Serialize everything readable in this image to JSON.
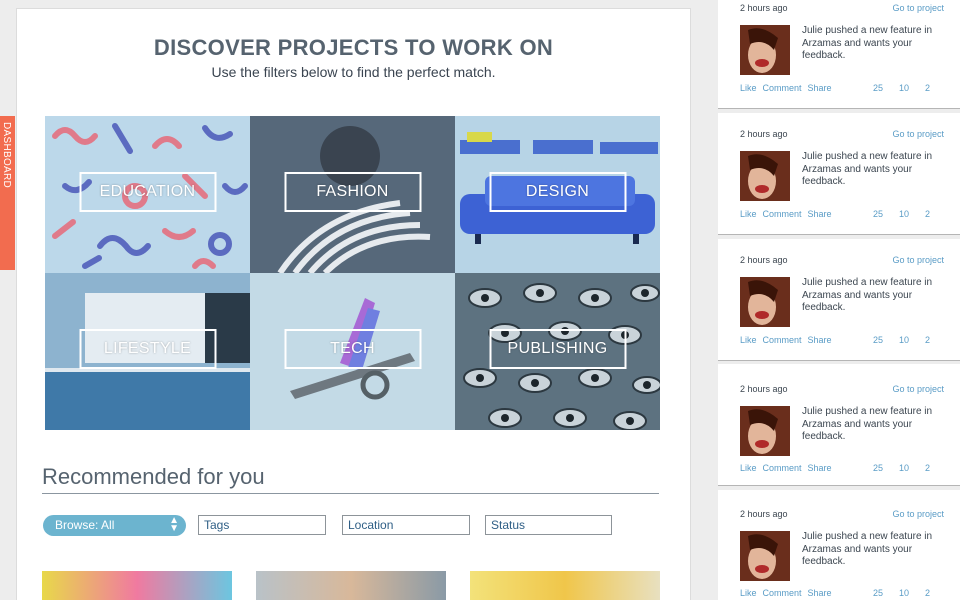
{
  "sidebar_tab": {
    "label": "DASHBOARD"
  },
  "header": {
    "title": "DISCOVER PROJECTS TO WORK ON",
    "subtitle": "Use the filters below to find the perfect match."
  },
  "categories": [
    {
      "label": "EDUCATION"
    },
    {
      "label": "FASHION"
    },
    {
      "label": "DESIGN"
    },
    {
      "label": "LIFESTYLE"
    },
    {
      "label": "TECH"
    },
    {
      "label": "PUBLISHING"
    }
  ],
  "recommended": {
    "title": "Recommended for you",
    "browse_value": "Browse: All",
    "filters": {
      "tags": "Tags",
      "location": "Location",
      "status": "Status"
    }
  },
  "feed": [
    {
      "time": "2 hours ago",
      "goto": "Go to project",
      "message": "Julie pushed a new feature in Arzamas and wants your feedback.",
      "like": "Like",
      "comment": "Comment",
      "share": "Share",
      "likes": "25",
      "comments": "10",
      "shares": "2"
    },
    {
      "time": "2 hours ago",
      "goto": "Go to project",
      "message": "Julie pushed a new feature in Arzamas and wants your feedback.",
      "like": "Like",
      "comment": "Comment",
      "share": "Share",
      "likes": "25",
      "comments": "10",
      "shares": "2"
    },
    {
      "time": "2 hours ago",
      "goto": "Go to project",
      "message": "Julie pushed a new feature in Arzamas and wants your feedback.",
      "like": "Like",
      "comment": "Comment",
      "share": "Share",
      "likes": "25",
      "comments": "10",
      "shares": "2"
    },
    {
      "time": "2 hours ago",
      "goto": "Go to project",
      "message": "Julie pushed a new feature in Arzamas and wants your feedback.",
      "like": "Like",
      "comment": "Comment",
      "share": "Share",
      "likes": "25",
      "comments": "10",
      "shares": "2"
    },
    {
      "time": "2 hours ago",
      "goto": "Go to project",
      "message": "Julie pushed a new feature in Arzamas and wants your feedback.",
      "like": "Like",
      "comment": "Comment",
      "share": "Share",
      "likes": "25",
      "comments": "10",
      "shares": "2"
    }
  ]
}
